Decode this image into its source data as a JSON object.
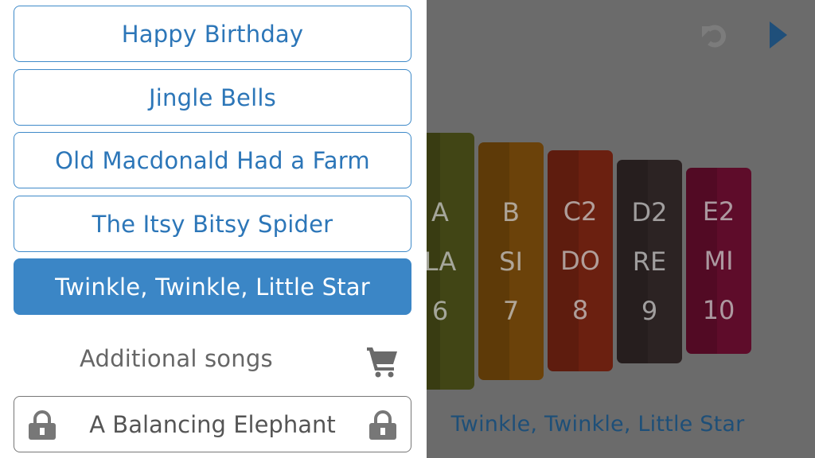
{
  "drawer": {
    "songs": [
      {
        "label": "Happy Birthday"
      },
      {
        "label": "Jingle Bells"
      },
      {
        "label": "Old Macdonald Had a Farm"
      },
      {
        "label": "The Itsy Bitsy Spider"
      },
      {
        "label": "Twinkle, Twinkle, Little Star"
      }
    ],
    "selected_index": 4,
    "additional_label": "Additional songs",
    "locked_song": {
      "label": "A Balancing Elephant"
    },
    "icons": {
      "cart": "cart-icon",
      "lock": "lock-icon"
    }
  },
  "toolbar": {
    "undo_icon": "undo-icon",
    "play_icon": "play-icon"
  },
  "xylophone": {
    "bars": [
      {
        "note": "A",
        "solfege": "LA",
        "number": "6",
        "color": "#414515"
      },
      {
        "note": "B",
        "solfege": "SI",
        "number": "7",
        "color": "#6b420a"
      },
      {
        "note": "C2",
        "solfege": "DO",
        "number": "8",
        "color": "#6b2010"
      },
      {
        "note": "D2",
        "solfege": "RE",
        "number": "9",
        "color": "#2c2323"
      },
      {
        "note": "E2",
        "solfege": "MI",
        "number": "10",
        "color": "#5e0c2a"
      }
    ]
  },
  "current_song": "Twinkle, Twinkle, Little Star",
  "colors": {
    "accent": "#3b86c6",
    "accent_text": "#2c76b8",
    "overlay": "#6b6b6b",
    "caption": "#1e4f78"
  }
}
